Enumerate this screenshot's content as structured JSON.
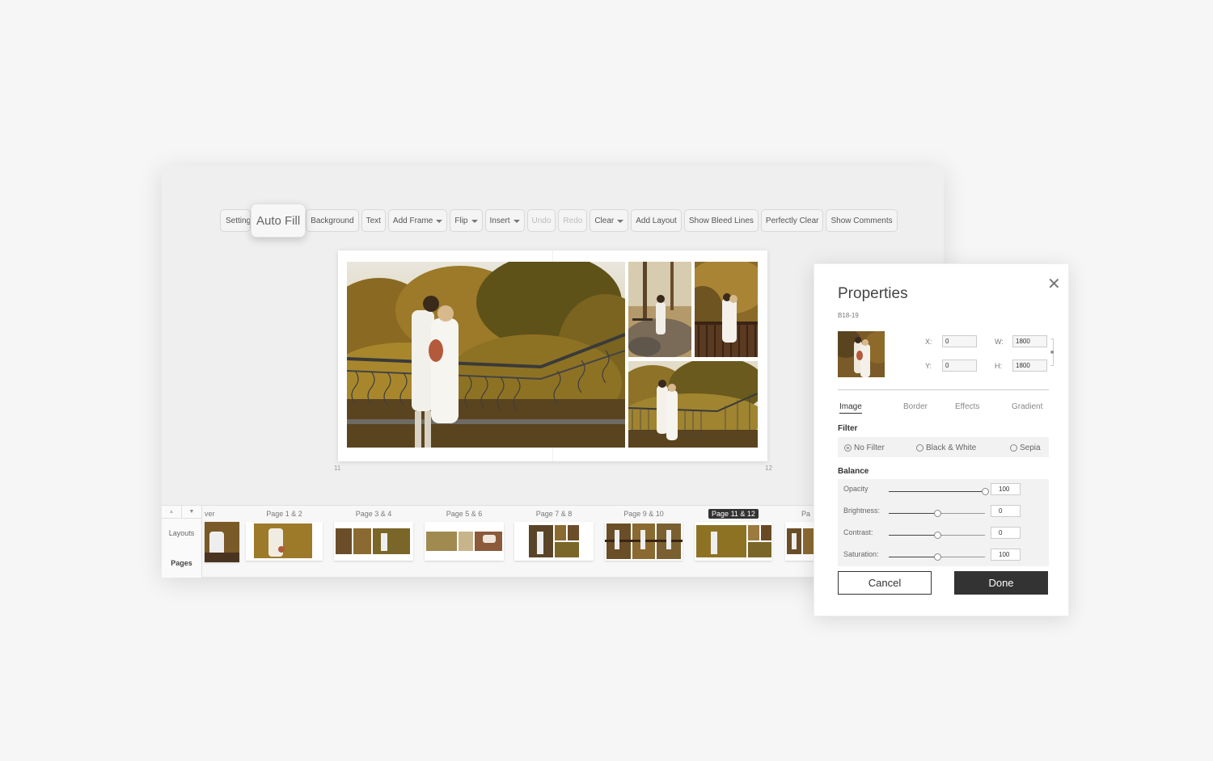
{
  "toolbar": {
    "items": [
      {
        "label": "Setting",
        "disabled": false
      },
      {
        "label": "Auto Fill",
        "disabled": false
      },
      {
        "label": "Background",
        "disabled": false
      },
      {
        "label": "Text",
        "disabled": false
      },
      {
        "label": "Add Frame",
        "disabled": false,
        "dropdown": true
      },
      {
        "label": "Flip",
        "disabled": false,
        "dropdown": true
      },
      {
        "label": "Insert",
        "disabled": false,
        "dropdown": true
      },
      {
        "label": "Undo",
        "disabled": true
      },
      {
        "label": "Redo",
        "disabled": true
      },
      {
        "label": "Clear",
        "disabled": false,
        "dropdown": true
      },
      {
        "label": "Add Layout",
        "disabled": false
      },
      {
        "label": "Show Bleed Lines",
        "disabled": false
      },
      {
        "label": "Perfectly Clear",
        "disabled": false
      },
      {
        "label": "Show Comments",
        "disabled": false
      }
    ]
  },
  "spread": {
    "left_page": "11",
    "right_page": "12"
  },
  "bottom_panel": {
    "up_arrow": "▲",
    "down_arrow": "▼",
    "tabs": [
      "Layouts",
      "Pages"
    ],
    "thumbnails": [
      {
        "label": "ver",
        "active": false
      },
      {
        "label": "Page 1 & 2",
        "active": false
      },
      {
        "label": "Page 3 & 4",
        "active": false
      },
      {
        "label": "Page 5 & 6",
        "active": false
      },
      {
        "label": "Page 7 & 8",
        "active": false
      },
      {
        "label": "Page 9 & 10",
        "active": false
      },
      {
        "label": "Page 11 & 12",
        "active": true
      },
      {
        "label": "Pa",
        "active": false
      }
    ]
  },
  "properties": {
    "title": "Properties",
    "close": "✕",
    "code": "B18-19",
    "fields": {
      "x_label": "X:",
      "x_value": "0",
      "y_label": "Y:",
      "y_value": "0",
      "w_label": "W:",
      "w_value": "1800",
      "h_label": "H:",
      "h_value": "1800"
    },
    "tabs": [
      "Image",
      "Border",
      "Effects",
      "Gradient"
    ],
    "active_tab": "Image",
    "filter_title": "Filter",
    "filters": [
      {
        "label": "No Filter",
        "selected": true
      },
      {
        "label": "Black & White",
        "selected": false
      },
      {
        "label": "Sepia",
        "selected": false
      }
    ],
    "balance_title": "Balance",
    "sliders": [
      {
        "label": "Opacity",
        "value": "100",
        "level": 1.0
      },
      {
        "label": "Brightness:",
        "value": "0",
        "level": 0.5
      },
      {
        "label": "Contrast:",
        "value": "0",
        "level": 0.5
      },
      {
        "label": "Saturation:",
        "value": "100",
        "level": 0.5
      }
    ],
    "cancel": "Cancel",
    "done": "Done"
  }
}
